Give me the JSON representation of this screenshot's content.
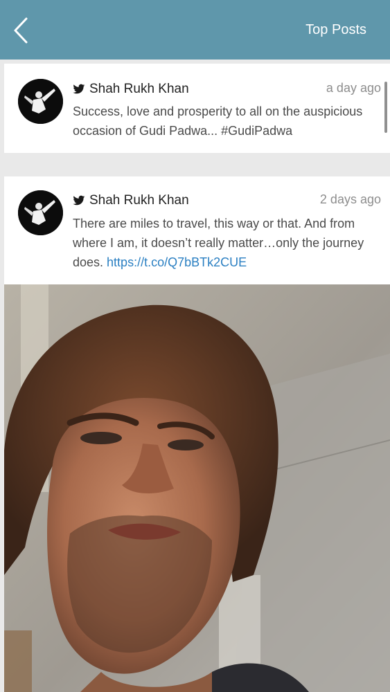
{
  "header": {
    "title": "Top Posts",
    "back_icon": "chevron-left-icon",
    "background_color": "#5f97ab"
  },
  "posts": [
    {
      "author": "Shah Rukh Khan",
      "source_icon": "twitter-bird-icon",
      "time": "a day ago",
      "text": "Success, love and prosperity to all on the auspicious occasion of Gudi Padwa... #GudiPadwa"
    },
    {
      "author": "Shah Rukh Khan",
      "source_icon": "twitter-bird-icon",
      "time": "2 days ago",
      "text": "There are miles to travel, this way or that. And from where I am, it doesn’t really matter…only the journey does. ",
      "link": "https://t.co/Q7bBTk2CUE"
    }
  ],
  "colors": {
    "link": "#2a7fc2",
    "timestamp": "#8d8d8d"
  }
}
